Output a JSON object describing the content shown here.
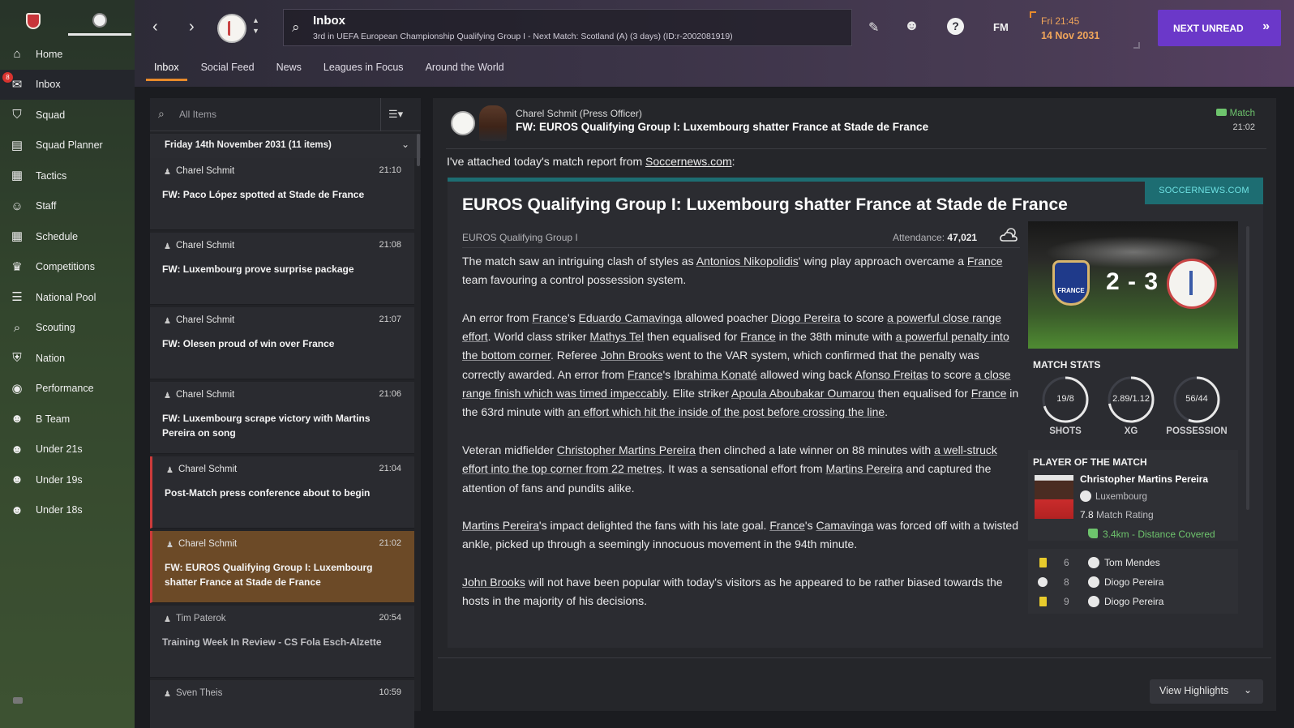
{
  "sidebar": {
    "items": [
      {
        "label": "Home",
        "icon": "home-icon"
      },
      {
        "label": "Inbox",
        "icon": "inbox-icon",
        "active": true,
        "badge": "8"
      },
      {
        "label": "Squad",
        "icon": "shirt-icon"
      },
      {
        "label": "Squad Planner",
        "icon": "clipboard-icon"
      },
      {
        "label": "Tactics",
        "icon": "tactics-board-icon"
      },
      {
        "label": "Staff",
        "icon": "staff-icon"
      },
      {
        "label": "Schedule",
        "icon": "calendar-icon"
      },
      {
        "label": "Competitions",
        "icon": "trophy-icon"
      },
      {
        "label": "National Pool",
        "icon": "list-icon"
      },
      {
        "label": "Scouting",
        "icon": "magnifier-icon"
      },
      {
        "label": "Nation",
        "icon": "shield-icon"
      },
      {
        "label": "Performance",
        "icon": "performance-icon"
      },
      {
        "label": "B Team",
        "icon": "team-icon"
      },
      {
        "label": "Under 21s",
        "icon": "u21-team-icon"
      },
      {
        "label": "Under 19s",
        "icon": "u19-team-icon"
      },
      {
        "label": "Under 18s",
        "icon": "u18-team-icon"
      }
    ]
  },
  "header": {
    "title": "Inbox",
    "subtitle": "3rd in UEFA European Championship Qualifying Group I - Next Match: Scotland (A) (3 days) (ID:r-2002081919)",
    "day_time": "Fri 21:45",
    "date": "14 Nov 2031",
    "fm_label": "FM",
    "next_button": "NEXT UNREAD",
    "tabs": [
      "Inbox",
      "Social Feed",
      "News",
      "Leagues in Focus",
      "Around the World"
    ]
  },
  "inbox_list": {
    "search_placeholder": "All Items",
    "group_title": "Friday 14th November 2031 (11 items)",
    "messages": [
      {
        "sender": "Charel Schmit",
        "time": "21:10",
        "subject": "FW: Paco López spotted at Stade de France"
      },
      {
        "sender": "Charel Schmit",
        "time": "21:08",
        "subject": "FW: Luxembourg prove surprise package"
      },
      {
        "sender": "Charel Schmit",
        "time": "21:07",
        "subject": "FW: Olesen proud of win over France"
      },
      {
        "sender": "Charel Schmit",
        "time": "21:06",
        "subject": "FW: Luxembourg scrape victory with Martins Pereira on song"
      },
      {
        "sender": "Charel Schmit",
        "time": "21:04",
        "subject": "Post-Match press conference about to begin"
      },
      {
        "sender": "Charel Schmit",
        "time": "21:02",
        "subject": "FW: EUROS Qualifying Group I: Luxembourg shatter France at Stade de France"
      },
      {
        "sender": "Tim Paterok",
        "time": "20:54",
        "subject": "Training Week In Review - CS Fola Esch-Alzette"
      },
      {
        "sender": "Sven Theis",
        "time": "10:59",
        "subject": ""
      }
    ]
  },
  "message": {
    "from": "Charel Schmit (Press Officer)",
    "subject": "FW: EUROS Qualifying Group I: Luxembourg shatter France at Stade de France",
    "tag": "Match",
    "time": "21:02",
    "intro_before": "I've attached today's match report from ",
    "intro_link": "Soccernews.com",
    "intro_after": ":",
    "source_badge": "SOCCERNEWS.COM",
    "headline": "EUROS Qualifying Group I: Luxembourg shatter France at Stade de France",
    "competition": "EUROS Qualifying Group I",
    "attendance_label": "Attendance:",
    "attendance_value": "47,021",
    "home_team_crest_text": "FRANCE",
    "score": "2 - 3",
    "stats_title": "MATCH STATS",
    "stats": [
      {
        "value": "19/8",
        "label": "SHOTS",
        "fraction": 0.7
      },
      {
        "value": "2.89/1.12",
        "label": "XG",
        "fraction": 0.72
      },
      {
        "value": "56/44",
        "label": "POSSESSION",
        "fraction": 0.56
      }
    ],
    "potm_title": "PLAYER OF THE MATCH",
    "potm_name": "Christopher Martins Pereira",
    "potm_club": "Luxembourg",
    "potm_rating": "7.8",
    "potm_rating_label": "Match Rating",
    "potm_distance": "3.4km - Distance Covered",
    "events": [
      {
        "icon": "yellow-card-icon",
        "minute": "6",
        "player": "Tom Mendes"
      },
      {
        "icon": "goal-ball-icon",
        "minute": "8",
        "player": "Diogo Pereira"
      },
      {
        "icon": "yellow-card-icon",
        "minute": "9",
        "player": "Diogo Pereira"
      }
    ],
    "view_highlights": "View Highlights"
  }
}
